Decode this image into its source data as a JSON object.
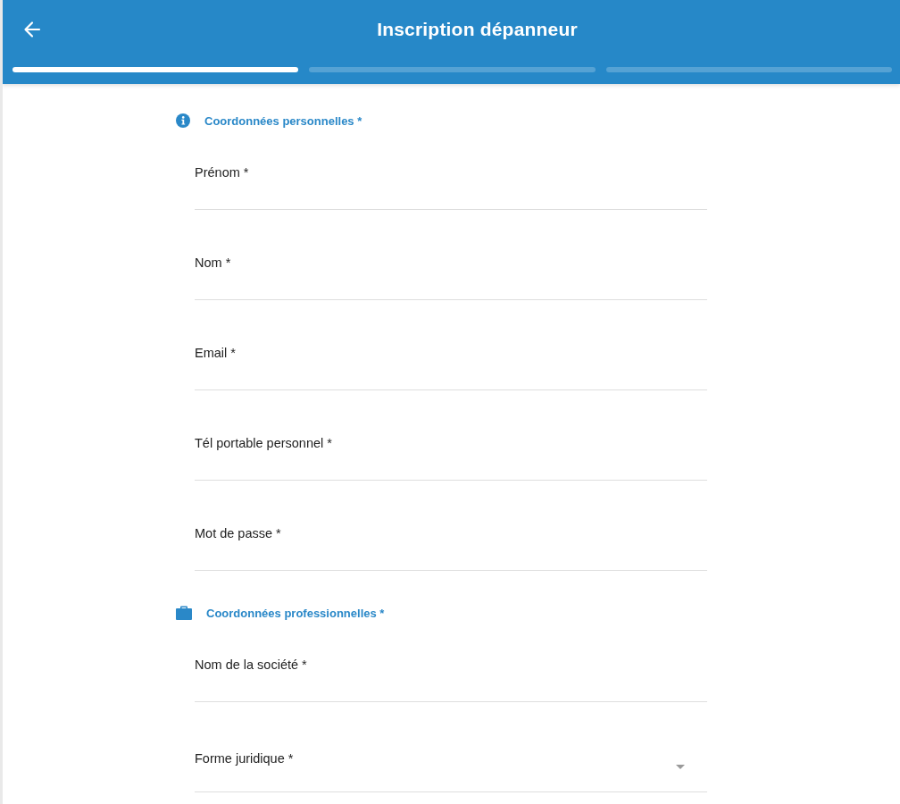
{
  "header": {
    "title": "Inscription dépanneur",
    "steps": [
      {
        "selected": true
      },
      {
        "selected": false
      },
      {
        "selected": false
      }
    ]
  },
  "sections": [
    {
      "kind": "personal",
      "title": "Coordonnées personnelles *",
      "fields": [
        {
          "kind": "text",
          "placeholder": "Prénom *"
        },
        {
          "kind": "text",
          "placeholder": "Nom *"
        },
        {
          "kind": "text",
          "placeholder": "Email *"
        },
        {
          "kind": "text",
          "placeholder": "Tél portable personnel *"
        },
        {
          "kind": "text",
          "placeholder": "Mot de passe *"
        }
      ]
    },
    {
      "kind": "professional",
      "title": "Coordonnées professionnelles *",
      "fields": [
        {
          "kind": "text",
          "placeholder": "Nom de la société *"
        },
        {
          "kind": "select",
          "placeholder": "Forme juridique *"
        }
      ]
    }
  ]
}
